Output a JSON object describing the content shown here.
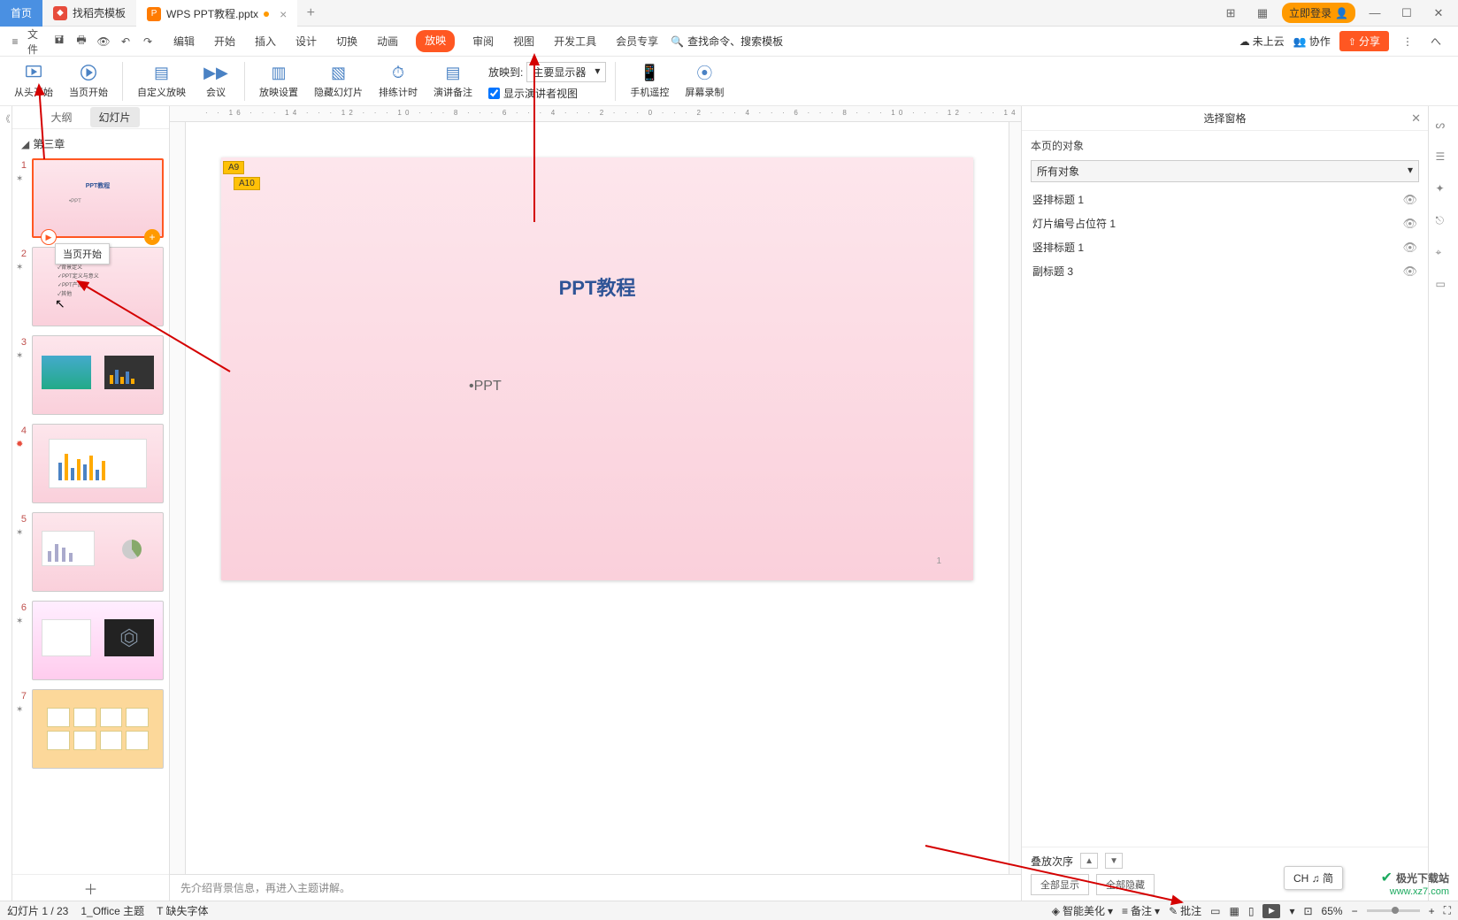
{
  "titlebar": {
    "home": "首页",
    "template_tab": "找稻壳模板",
    "file_tab": "WPS PPT教程.pptx",
    "login": "立即登录"
  },
  "menubar": {
    "file": "文件",
    "tabs": [
      "编辑",
      "开始",
      "插入",
      "设计",
      "切换",
      "动画",
      "放映",
      "审阅",
      "视图",
      "开发工具",
      "会员专享"
    ],
    "active_index": 6,
    "search_placeholder": "查找命令、搜索模板",
    "cloud": "未上云",
    "collab": "协作",
    "share": "分享"
  },
  "ribbon": {
    "btns": [
      {
        "label": "从头开始"
      },
      {
        "label": "当页开始"
      },
      {
        "label": "自定义放映"
      },
      {
        "label": "会议"
      },
      {
        "label": "放映设置"
      },
      {
        "label": "隐藏幻灯片"
      },
      {
        "label": "排练计时"
      },
      {
        "label": "演讲备注"
      }
    ],
    "project_to": "放映到:",
    "project_value": "主要显示器",
    "presenter_view": "显示演讲者视图",
    "phone": "手机遥控",
    "record": "屏幕录制"
  },
  "thumb_panel": {
    "tab_outline": "大纲",
    "tab_slides": "幻灯片",
    "section": "第三章",
    "tooltip": "当页开始",
    "slides": [
      1,
      2,
      3,
      4,
      5,
      6,
      7
    ]
  },
  "slide": {
    "marker1": "A9",
    "marker2": "A10",
    "title": "PPT教程",
    "subtitle": "•PPT",
    "page_num": "1"
  },
  "notes": "先介绍背景信息，再进入主题讲解。",
  "sel_panel": {
    "title": "选择窗格",
    "subtitle": "本页的对象",
    "filter": "所有对象",
    "items": [
      "竖排标题 1",
      "灯片编号占位符 1",
      "竖排标题 1",
      "副标题 3"
    ],
    "order": "叠放次序",
    "show_all": "全部显示",
    "hide_all": "全部隐藏"
  },
  "statusbar": {
    "slide_info": "幻灯片 1 / 23",
    "theme": "1_Office 主题",
    "missing_font": "缺失字体",
    "beautify": "智能美化",
    "notes": "备注",
    "comments": "批注",
    "zoom": "65%"
  },
  "ime": "CH ♫ 简",
  "watermark": {
    "name": "极光下载站",
    "url": "www.xz7.com"
  }
}
